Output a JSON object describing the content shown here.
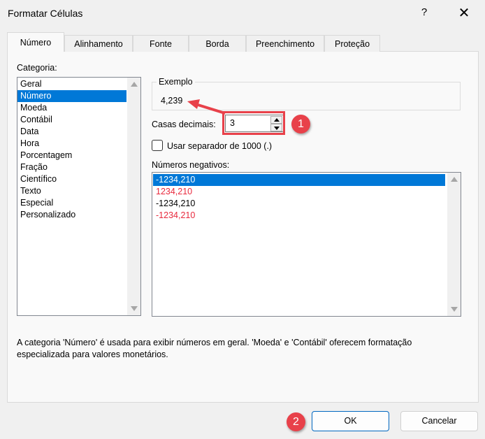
{
  "window": {
    "title": "Formatar Células",
    "help": "?",
    "close": "✕"
  },
  "tabs": [
    "Número",
    "Alinhamento",
    "Fonte",
    "Borda",
    "Preenchimento",
    "Proteção"
  ],
  "category": {
    "label": "Categoria:",
    "items": [
      "Geral",
      "Número",
      "Moeda",
      "Contábil",
      "Data",
      "Hora",
      "Porcentagem",
      "Fração",
      "Científico",
      "Texto",
      "Especial",
      "Personalizado"
    ],
    "selected": "Número"
  },
  "example": {
    "label": "Exemplo",
    "value": "4,239"
  },
  "decimals": {
    "label": "Casas decimais:",
    "value": "3"
  },
  "separator": {
    "label": "Usar separador de 1000 (.)",
    "checked": false
  },
  "negatives": {
    "label": "Números negativos:",
    "items": [
      {
        "text": "-1234,210",
        "color": "#000000",
        "selected": true
      },
      {
        "text": "1234,210",
        "color": "#e8283c"
      },
      {
        "text": "-1234,210",
        "color": "#000000"
      },
      {
        "text": "-1234,210",
        "color": "#e8283c"
      }
    ]
  },
  "description": "A categoria 'Número' é usada para exibir números em geral. 'Moeda' e 'Contábil' oferecem formatação especializada para valores monetários.",
  "buttons": {
    "ok": "OK",
    "cancel": "Cancelar"
  },
  "annotations": {
    "badge1": "1",
    "badge2": "2",
    "color": "#e8414a"
  }
}
